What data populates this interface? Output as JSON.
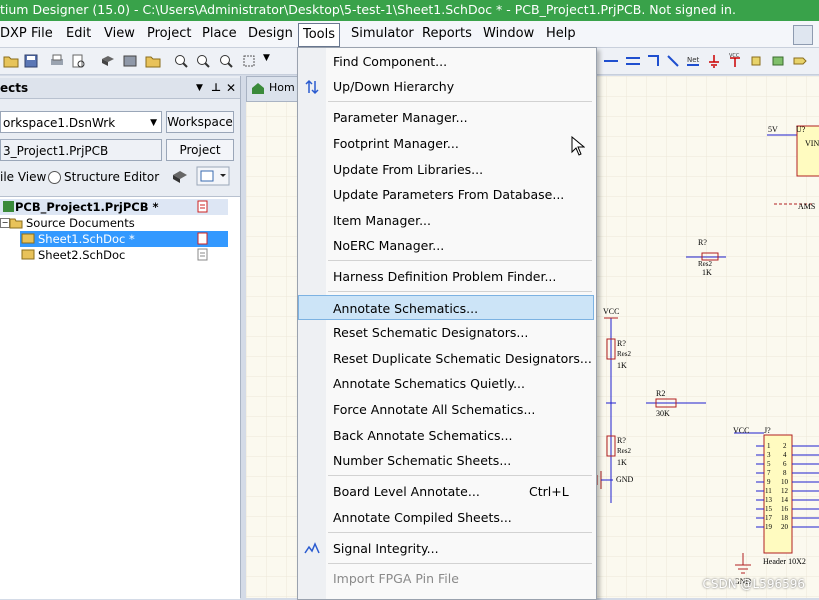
{
  "window": {
    "title": "tium Designer (15.0) - C:\\Users\\Administrator\\Desktop\\5-test-1\\Sheet1.SchDoc * - PCB_Project1.PrjPCB. Not signed in."
  },
  "menubar": {
    "items": [
      "DXP",
      "File",
      "Edit",
      "View",
      "Project",
      "Place",
      "Design",
      "Tools",
      "Simulator",
      "Reports",
      "Window",
      "Help"
    ]
  },
  "panel": {
    "title": "ects",
    "workspace_combo": "orkspace1.DsnWrk",
    "workspace_button": "Workspace",
    "project_field": "3_Project1.PrjPCB",
    "project_button": "Project",
    "file_view_label": "ile View",
    "structure_editor_label": "Structure Editor",
    "tree": {
      "project": "PCB_Project1.PrjPCB *",
      "folder": "Source Documents",
      "doc1": "Sheet1.SchDoc *",
      "doc2": "Sheet2.SchDoc"
    }
  },
  "doc_tab": "Hom",
  "tools_menu": {
    "items": [
      {
        "label": "Find Component...",
        "shortcut": ""
      },
      {
        "label": "Up/Down Hierarchy",
        "shortcut": ""
      },
      {
        "label": "Parameter Manager...",
        "shortcut": ""
      },
      {
        "label": "Footprint Manager...",
        "shortcut": ""
      },
      {
        "label": "Update From Libraries...",
        "shortcut": ""
      },
      {
        "label": "Update Parameters From Database...",
        "shortcut": ""
      },
      {
        "label": "Item Manager...",
        "shortcut": ""
      },
      {
        "label": "NoERC Manager...",
        "shortcut": ""
      },
      {
        "label": "Harness Definition Problem Finder...",
        "shortcut": ""
      },
      {
        "label": "Annotate Schematics...",
        "shortcut": ""
      },
      {
        "label": "Reset Schematic Designators...",
        "shortcut": ""
      },
      {
        "label": "Reset Duplicate Schematic Designators...",
        "shortcut": ""
      },
      {
        "label": "Annotate Schematics Quietly...",
        "shortcut": ""
      },
      {
        "label": "Force Annotate All Schematics...",
        "shortcut": ""
      },
      {
        "label": "Back Annotate Schematics...",
        "shortcut": ""
      },
      {
        "label": "Number Schematic Sheets...",
        "shortcut": ""
      },
      {
        "label": "Board Level Annotate...",
        "shortcut": "Ctrl+L"
      },
      {
        "label": "Annotate Compiled Sheets...",
        "shortcut": ""
      },
      {
        "label": "Signal Integrity...",
        "shortcut": ""
      },
      {
        "label": "Import FPGA Pin File",
        "shortcut": ""
      }
    ]
  },
  "schematic": {
    "labels": {
      "v5": "5V",
      "u7": "U?",
      "vin": "VIN",
      "ams": "AMS",
      "r_top": "R?",
      "res2_top": "Res2",
      "k1_top": "1K",
      "vcc1": "VCC",
      "r_mid": "R?",
      "res2_mid": "Res2",
      "k1_mid": "1K",
      "r2": "R2",
      "k30": "30K",
      "r_low": "R?",
      "res2_low": "Res2",
      "k1_low": "1K",
      "gnd1": "GND",
      "vcc2": "VCC",
      "jq": "J?",
      "gnd2": "GND",
      "header": "Header 10X2"
    },
    "header_pins": [
      "1",
      "2",
      "3",
      "4",
      "5",
      "6",
      "7",
      "8",
      "9",
      "10",
      "11",
      "12",
      "13",
      "14",
      "15",
      "16",
      "17",
      "18",
      "19",
      "20"
    ]
  },
  "watermark": "CSDN @L596596",
  "colors": {
    "titlebar": "#39a24a",
    "highlight": "#cce4f7",
    "schematic_bg": "#fbf9ef",
    "wire": "#1f1fcf",
    "part_red": "#b02020"
  }
}
